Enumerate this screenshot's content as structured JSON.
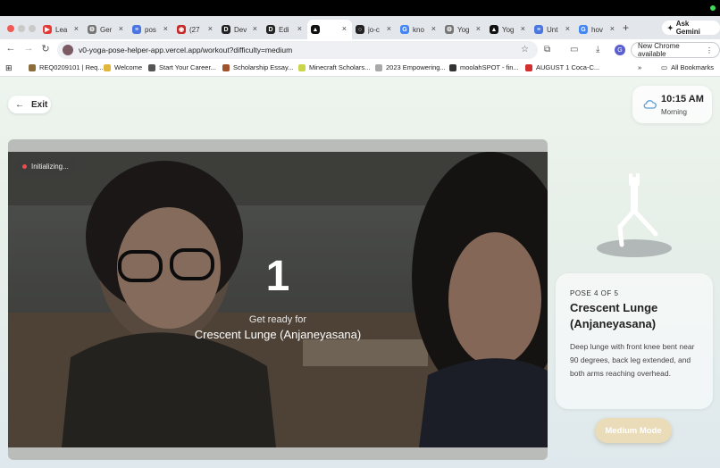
{
  "browser": {
    "tabs": [
      {
        "label": "Lea",
        "color": "#e53935",
        "glyph": "▶"
      },
      {
        "label": "Ger",
        "color": "#777777",
        "glyph": "⚙"
      },
      {
        "label": "pos",
        "color": "#4a76e0",
        "glyph": "≡"
      },
      {
        "label": "(27",
        "color": "#c62828",
        "glyph": "◉"
      },
      {
        "label": "Dev",
        "color": "#222222",
        "glyph": "D"
      },
      {
        "label": "Edi",
        "color": "#222222",
        "glyph": "D"
      },
      {
        "label": "",
        "color": "#111111",
        "glyph": "▲",
        "active": true
      },
      {
        "label": "jo-c",
        "color": "#222222",
        "glyph": "○"
      },
      {
        "label": "kno",
        "color": "#4285f4",
        "glyph": "G"
      },
      {
        "label": "Yog",
        "color": "#777777",
        "glyph": "⚙"
      },
      {
        "label": "Yog",
        "color": "#111111",
        "glyph": "▲"
      },
      {
        "label": "Unt",
        "color": "#4a76e0",
        "glyph": "≡"
      },
      {
        "label": "hov",
        "color": "#4285f4",
        "glyph": "G"
      }
    ],
    "ask_gemini": "Ask Gemini",
    "url": "v0-yoga-pose-helper-app.vercel.app/workout?difficulty=medium",
    "profile_initial": "G",
    "new_chrome": "New Chrome available",
    "bookmarks": [
      {
        "label": "REQ0209101 | Req...",
        "color": "#8a6d3b"
      },
      {
        "label": "Welcome",
        "color": "#e0b73a"
      },
      {
        "label": "Start Your Career...",
        "color": "#555555"
      },
      {
        "label": "Scholarship Essay...",
        "color": "#a0522d"
      },
      {
        "label": "Minecraft Scholars...",
        "color": "#c9d64a"
      },
      {
        "label": "2023 Empowering...",
        "color": "#aaaaaa"
      },
      {
        "label": "moolahSPOT - fin...",
        "color": "#333333"
      },
      {
        "label": "AUGUST 1 Coca-C...",
        "color": "#d32f2f"
      }
    ],
    "all_bookmarks": "All Bookmarks"
  },
  "header": {
    "exit_label": "Exit",
    "time": "10:15 AM",
    "period": "Morning"
  },
  "camera": {
    "status": "Initializing...",
    "countdown": "1",
    "get_ready": "Get ready for",
    "pose_name": "Crescent Lunge (Anjaneyasana)"
  },
  "pose_card": {
    "counter": "POSE 4 OF 5",
    "name": "Crescent Lunge (Anjaneyasana)",
    "description": "Deep lunge with front knee bent near 90 degrees, back leg extended, and both arms reaching overhead."
  },
  "mode_button": "Medium Mode",
  "colors": {
    "mode_button": "#eadcb8",
    "status_dot": "#ef4d4d",
    "page_bg": "#e7efe9"
  }
}
